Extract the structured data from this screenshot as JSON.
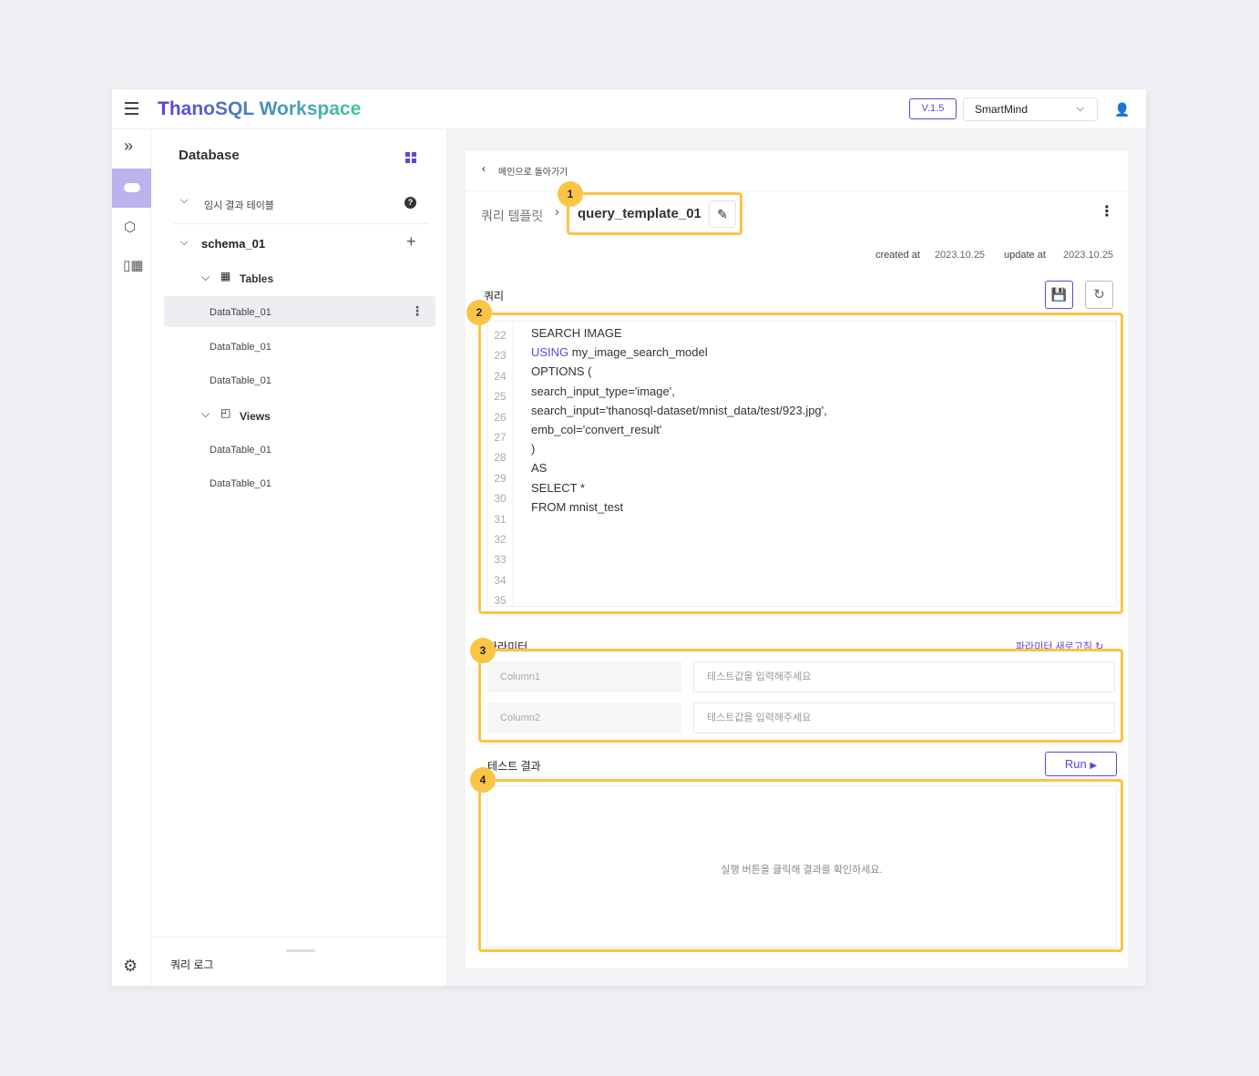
{
  "header": {
    "title": "ThanoSQL Workspace",
    "version": "V.1.5",
    "workspace": "SmartMind"
  },
  "sidebar": {
    "title": "Database",
    "temp_tables": "임시 결과 테이블",
    "schema": "schema_01",
    "tables_label": "Tables",
    "tables": [
      "DataTable_01",
      "DataTable_01",
      "DataTable_01"
    ],
    "views_label": "Views",
    "views": [
      "DataTable_01",
      "DataTable_01"
    ],
    "query_log": "쿼리 로그"
  },
  "main": {
    "back": "메인으로 돌아가기",
    "breadcrumb_parent": "쿼리 템플릿",
    "template_name": "query_template_01",
    "created_label": "created at",
    "created": "2023.10.25",
    "updated_label": "update at",
    "updated": "2023.10.25",
    "query_label": "쿼리",
    "line_numbers": [
      "22",
      "23",
      "24",
      "25",
      "26",
      "27",
      "28",
      "29",
      "30",
      "31",
      "32",
      "33",
      "34",
      "35"
    ],
    "code": [
      [
        "",
        "SEARCH IMAGE"
      ],
      [
        "USING",
        " my_image_search_model"
      ],
      [
        "",
        "OPTIONS ("
      ],
      [
        "",
        "search_input_type='image',"
      ],
      [
        "",
        "search_input='thanosql-dataset/mnist_data/test/923.jpg',"
      ],
      [
        "",
        "emb_col='convert_result'"
      ],
      [
        "",
        ")"
      ],
      [
        "",
        "AS"
      ],
      [
        "",
        "SELECT *"
      ],
      [
        "",
        "FROM mnist_test"
      ]
    ],
    "params_label": "파라미터",
    "params_refresh": "파라미터 새로고침",
    "params": [
      {
        "name": "Column1",
        "placeholder": "테스트값을 입력해주세요"
      },
      {
        "name": "Column2",
        "placeholder": "테스트값을 입력해주세요"
      }
    ],
    "result_label": "테스트 결과",
    "run": "Run",
    "result_empty": "실행 버튼을 클릭해 결과를 확인하세요."
  },
  "annotations": [
    "1",
    "2",
    "3",
    "4"
  ],
  "colors": {
    "accent": "#5b49d6",
    "highlight": "#fbc445",
    "keyword": "#5b49d6"
  }
}
